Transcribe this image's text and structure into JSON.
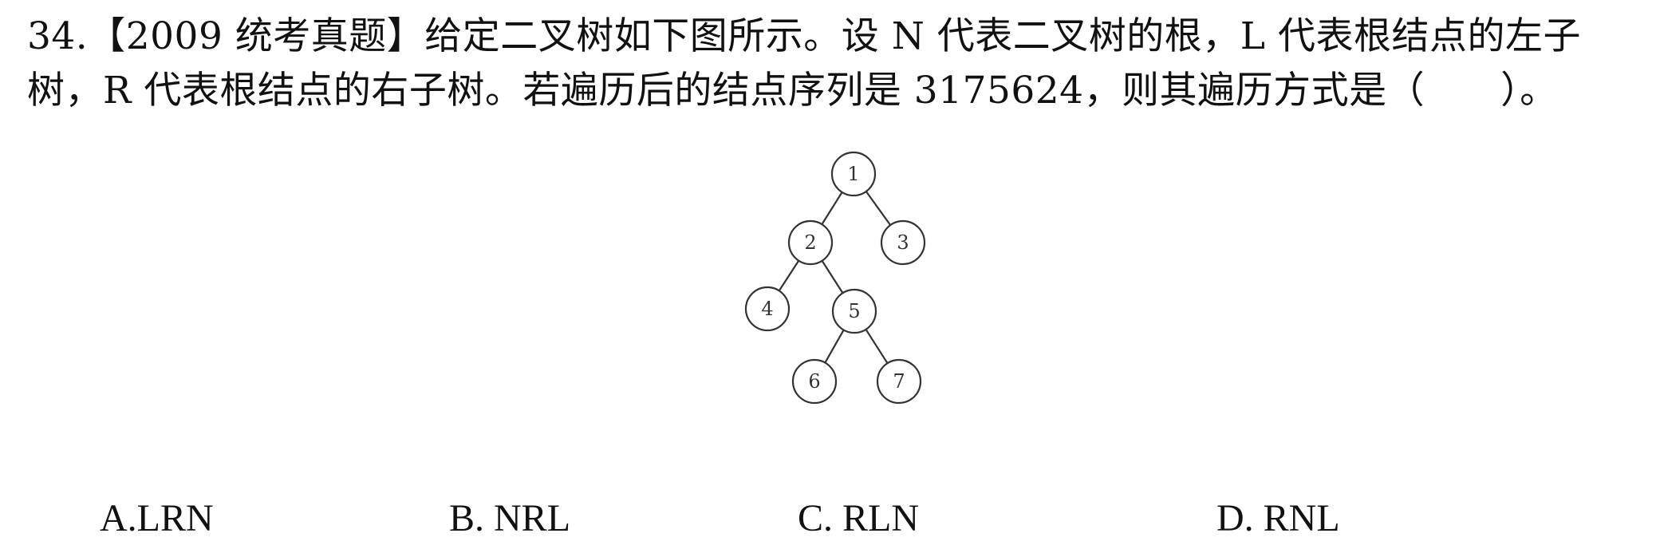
{
  "question": {
    "line1": "34.【2009 统考真题】给定二叉树如下图所示。设 N 代表二叉树的根，L 代表根结点的左子",
    "line2": "树，R 代表根结点的右子树。若遍历后的结点序列是 3175624，则其遍历方式是（　　）。"
  },
  "tree": {
    "nodes": [
      {
        "label": "1"
      },
      {
        "label": "2"
      },
      {
        "label": "3"
      },
      {
        "label": "4"
      },
      {
        "label": "5"
      },
      {
        "label": "6"
      },
      {
        "label": "7"
      }
    ],
    "edges": [
      [
        "1",
        "2"
      ],
      [
        "1",
        "3"
      ],
      [
        "2",
        "4"
      ],
      [
        "2",
        "5"
      ],
      [
        "5",
        "6"
      ],
      [
        "5",
        "7"
      ]
    ]
  },
  "options": [
    {
      "label": "A.LRN"
    },
    {
      "label": "B. NRL"
    },
    {
      "label": "C. RLN"
    },
    {
      "label": "D. RNL"
    }
  ]
}
